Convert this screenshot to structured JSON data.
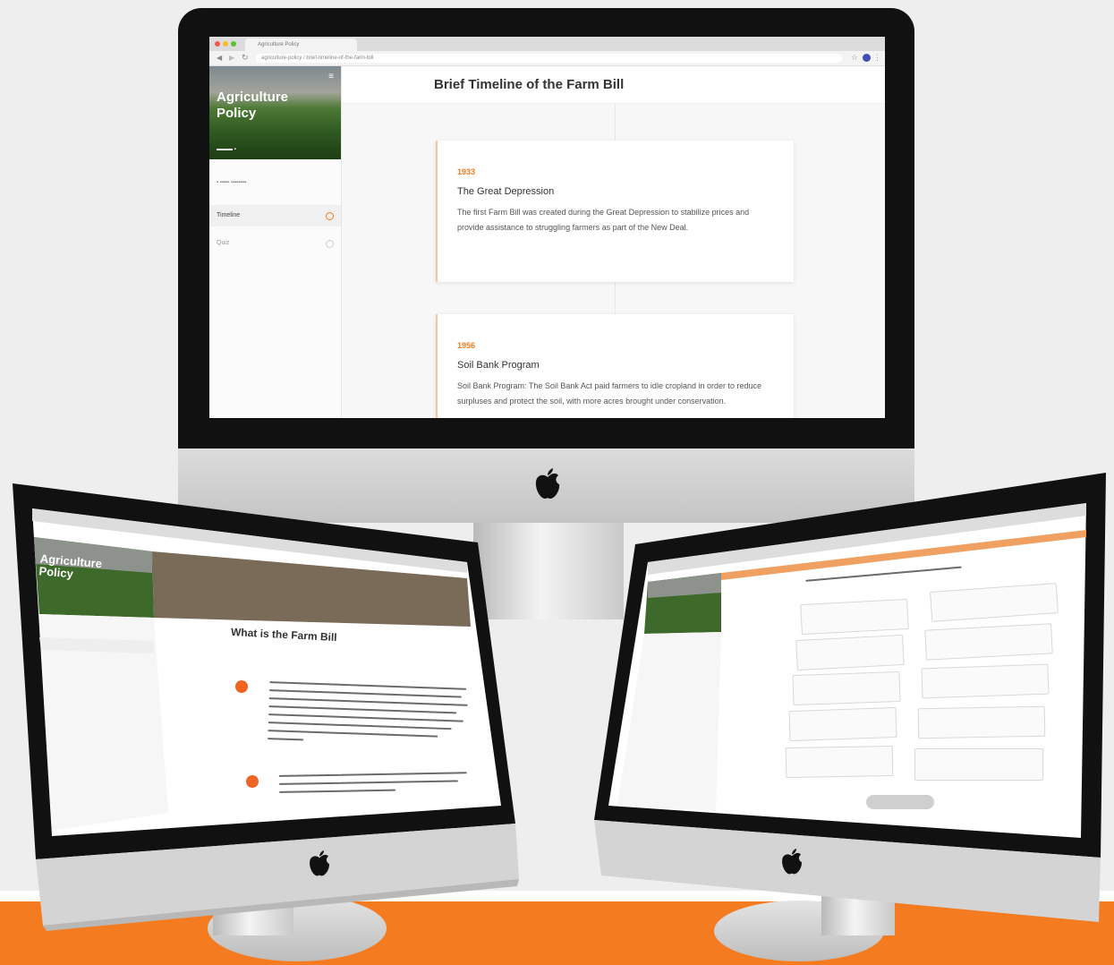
{
  "main": {
    "tab_title": "Agriculture Policy",
    "url": "agriculture-policy / brief-timeline-of-the-farm-bill",
    "app_title": "Agriculture Policy",
    "page_title": "Brief Timeline of the Farm Bill",
    "sidebar_items": [
      "Timeline",
      "Quiz"
    ],
    "cards": [
      {
        "year": "1933",
        "heading": "The Great Depression",
        "body": "The first Farm Bill was created during the Great Depression to stabilize prices and provide assistance to struggling farmers as part of the New Deal."
      },
      {
        "year": "1956",
        "heading": "Soil Bank Program",
        "body": "Soil Bank Program: The Soil Bank Act paid farmers to idle cropland in order to reduce surpluses and protect the soil, with more acres brought under conservation."
      }
    ]
  },
  "left": {
    "app_title": "Agriculture Policy",
    "page_title": "What is the Farm Bill"
  },
  "colors": {
    "accent": "#f47b20",
    "floor": "#f47b20",
    "bezel": "#111111",
    "background": "#eeeeee"
  },
  "icons": [
    "apple-logo-icon",
    "menu-icon",
    "browser-dot-icons"
  ]
}
